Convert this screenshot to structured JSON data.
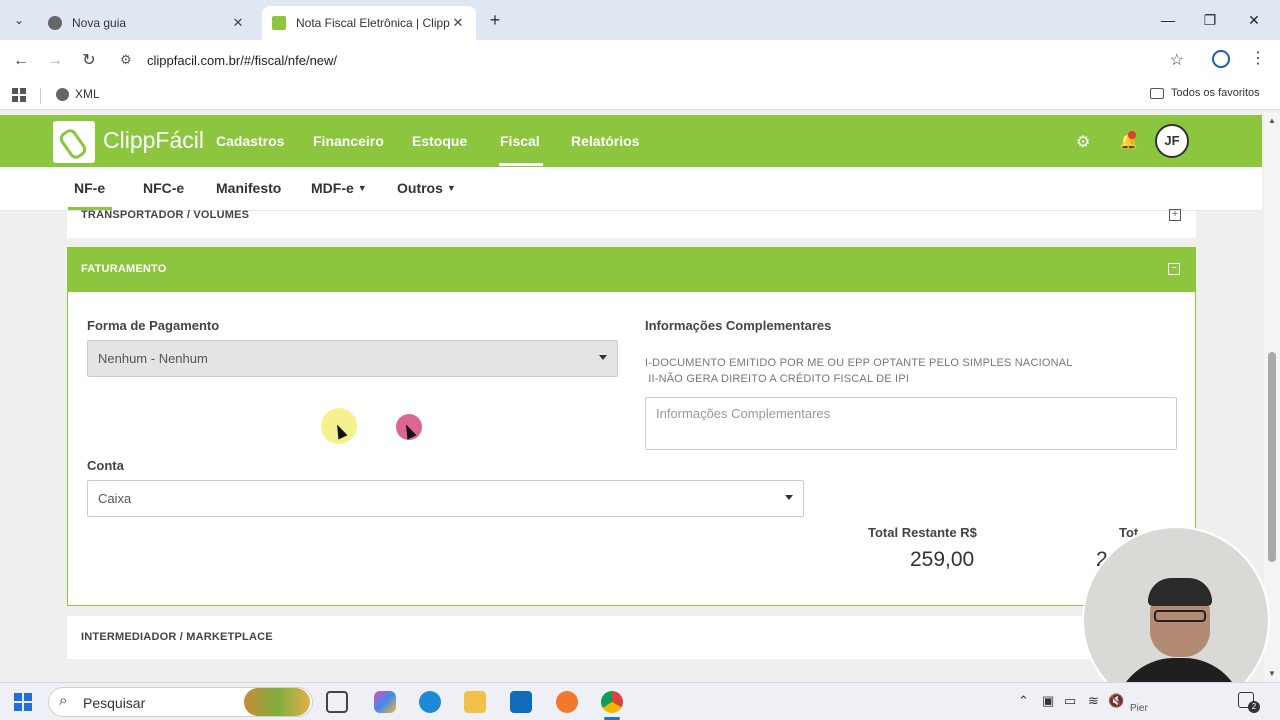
{
  "browser": {
    "tabs": [
      {
        "title": "Nova guia",
        "active": false
      },
      {
        "title": "Nota Fiscal Eletrônica | ClippFá",
        "active": true
      }
    ],
    "url": "clippfacil.com.br/#/fiscal/nfe/new/",
    "bookmarks": {
      "xml": "XML",
      "all": "Todos os favoritos"
    }
  },
  "app": {
    "logo_text": "ClippFácil",
    "main_menu": [
      "Cadastros",
      "Financeiro",
      "Estoque",
      "Fiscal",
      "Relatórios"
    ],
    "active_main": "Fiscal",
    "avatar": "JF",
    "sub_menu": [
      "NF-e",
      "NFC-e",
      "Manifesto",
      "MDF-e",
      "Outros"
    ],
    "active_sub": "NF-e"
  },
  "sections": {
    "transportador": "TRANSPORTADOR / VOLUMES",
    "faturamento": "FATURAMENTO",
    "intermediador": "INTERMEDIADOR / MARKETPLACE"
  },
  "form": {
    "forma_pagamento_label": "Forma de Pagamento",
    "forma_pagamento_value": "Nenhum - Nenhum",
    "info_label": "Informações Complementares",
    "info_text_1": "I-DOCUMENTO EMITIDO POR ME OU EPP OPTANTE PELO SIMPLES NACIONAL",
    "info_text_2": " II-NÃO GERA DIREITO A CRÉDITO FISCAL DE IPI",
    "info_placeholder": "Informações Complementares",
    "conta_label": "Conta",
    "conta_value": "Caixa",
    "total_restante_label": "Total Restante R$",
    "total_restante_value": "259,00",
    "total_label_partial": "Tot",
    "total_value_partial": "2"
  },
  "taskbar": {
    "search": "Pesquisar",
    "time_partial": "Pier"
  },
  "colors": {
    "brand_green": "#8cc63f",
    "chrome_tabbar": "#dfe7f3"
  }
}
